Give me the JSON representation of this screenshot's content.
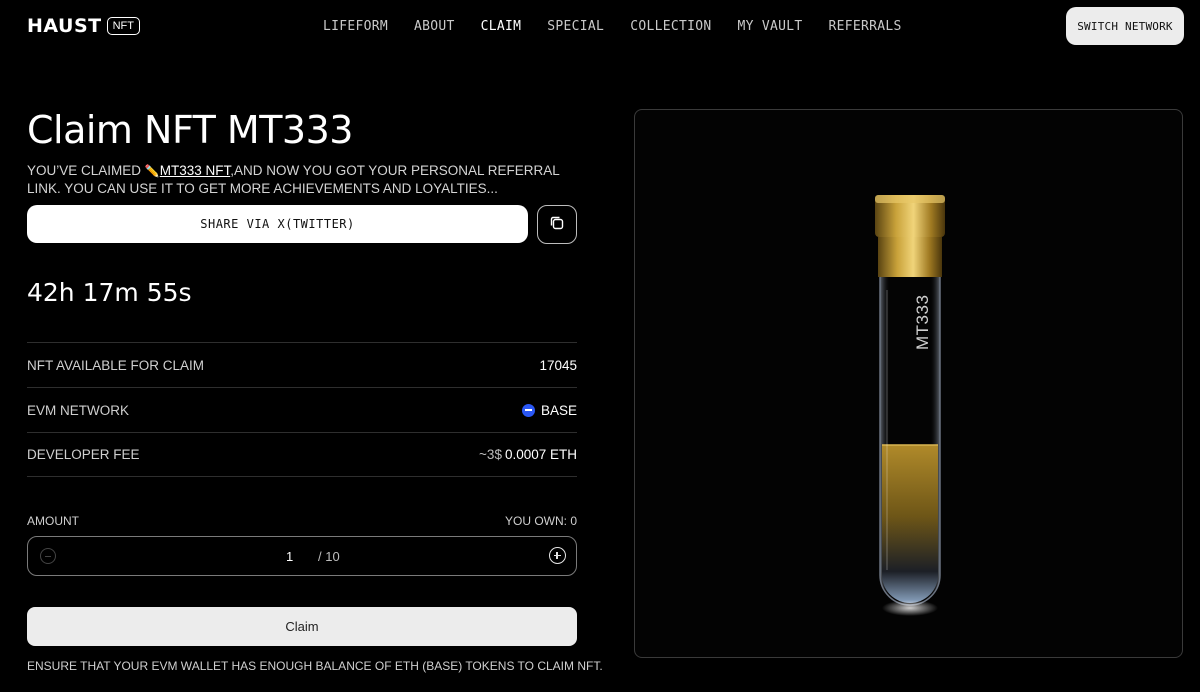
{
  "header": {
    "logo_text": "HAUST",
    "logo_badge": "NFT",
    "nav": [
      "LIFEFORM",
      "ABOUT",
      "CLAIM",
      "SPECIAL",
      "COLLECTION",
      "MY VAULT",
      "REFERRALS"
    ],
    "active_nav": "CLAIM",
    "switch_network_label": "SWITCH NETWORK"
  },
  "claim": {
    "title": "Claim NFT MT333",
    "desc_prefix": "YOU’VE CLAIMED ",
    "desc_link": "MT333 NFT",
    "desc_suffix": ",AND NOW YOU GOT YOUR PERSONAL REFERRAL LINK. YOU CAN USE IT TO GET MORE ACHIEVEMENTS AND LOYALTIES...",
    "share_label": "SHARE VIA X(TWITTER)",
    "timer": "42h 17m 55s"
  },
  "details": {
    "available_label": "NFT AVAILABLE FOR CLAIM",
    "available_value": "17045",
    "network_label": "EVM NETWORK",
    "network_value": "BASE",
    "fee_label": "DEVELOPER FEE",
    "fee_usd": "~3$",
    "fee_eth": "0.0007 ETH"
  },
  "amount": {
    "label": "AMOUNT",
    "own_label": "YOU OWN: 0",
    "quantity": "1",
    "max": "/ 10"
  },
  "claim_button_label": "Claim",
  "note": "ENSURE THAT YOUR EVM WALLET HAS ENOUGH BALANCE OF ETH (BASE) TOKENS TO CLAIM NFT.",
  "artwork": {
    "tube_label": "MT333"
  },
  "colors": {
    "background": "#000000",
    "base_blue": "#2a57f5",
    "gold": "#b8902a"
  }
}
